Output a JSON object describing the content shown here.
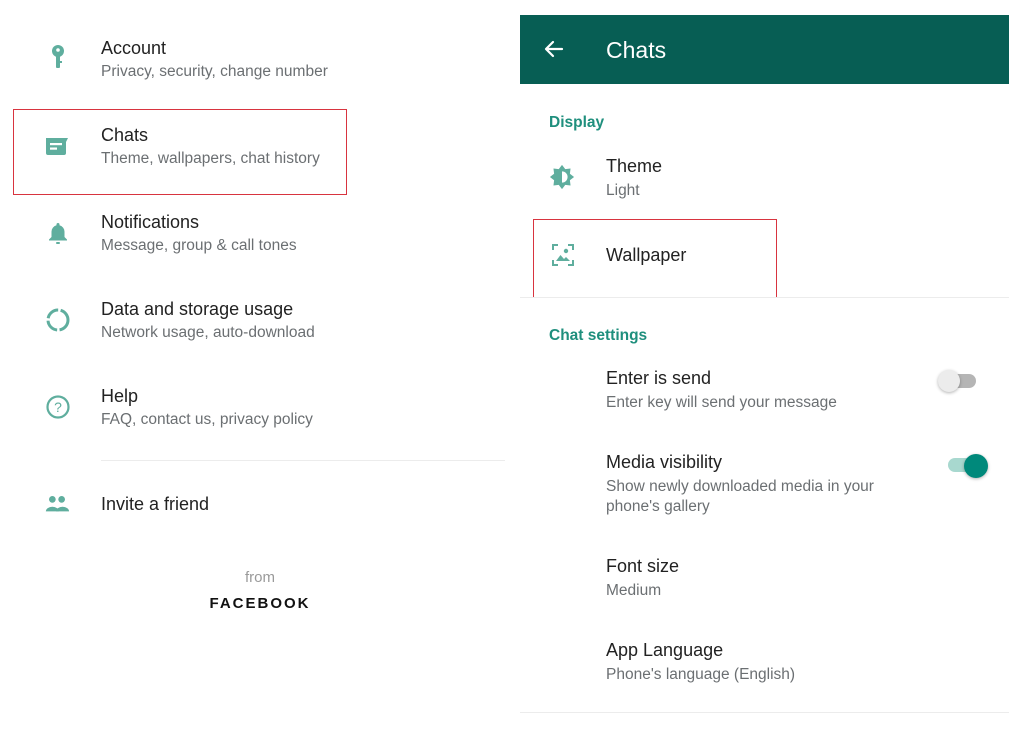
{
  "left_panel": {
    "items": [
      {
        "icon": "key-icon",
        "title": "Account",
        "subtitle": "Privacy, security, change number"
      },
      {
        "icon": "chat-icon",
        "title": "Chats",
        "subtitle": "Theme, wallpapers, chat history"
      },
      {
        "icon": "bell-icon",
        "title": "Notifications",
        "subtitle": "Message, group & call tones"
      },
      {
        "icon": "data-usage-icon",
        "title": "Data and storage usage",
        "subtitle": "Network usage, auto-download"
      },
      {
        "icon": "help-icon",
        "title": "Help",
        "subtitle": "FAQ, contact us, privacy policy"
      }
    ],
    "invite": {
      "icon": "people-icon",
      "label": "Invite a friend"
    },
    "footer": {
      "from": "from",
      "brand": "FACEBOOK"
    }
  },
  "right_panel": {
    "appbar": {
      "back_icon": "arrow-left-icon",
      "title": "Chats",
      "color": "#075e54"
    },
    "display_section": {
      "header": "Display",
      "theme": {
        "title": "Theme",
        "value": "Light"
      },
      "wallpaper": {
        "title": "Wallpaper"
      }
    },
    "chat_settings_section": {
      "header": "Chat settings",
      "enter_is_send": {
        "title": "Enter is send",
        "subtitle": "Enter key will send your message",
        "enabled": false
      },
      "media_visibility": {
        "title": "Media visibility",
        "subtitle_line1": "Show newly downloaded media in your",
        "subtitle_line2": "phone's gallery",
        "enabled": true
      },
      "font_size": {
        "title": "Font size",
        "value": "Medium"
      },
      "app_language": {
        "title": "App Language",
        "value": "Phone's language (English)"
      }
    }
  },
  "colors": {
    "accent": "#1f8f7d",
    "icon": "#5fae9e",
    "highlight": "#d8343f",
    "toggle_on": "#00897b"
  }
}
